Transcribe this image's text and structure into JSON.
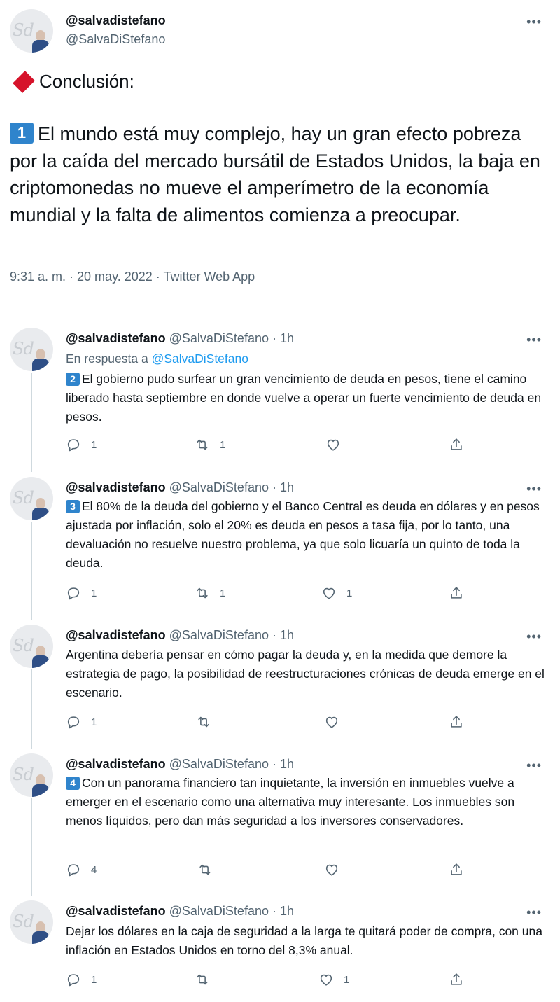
{
  "main_tweet": {
    "display_name": "@salvadistefano",
    "handle": "@SalvaDiStefano",
    "heading": "Conclusión:",
    "keycap": "1",
    "body": "El mundo está muy complejo, hay un gran efecto pobreza por la caída del mercado bursátil de Estados Unidos, la baja en criptomonedas no mueve el amperímetro de la economía mundial y la falta de alimentos comienza a preocupar.",
    "meta": "9:31 a. m. · 20 may. 2022 · Twitter Web App",
    "more_label": "•••"
  },
  "replies": [
    {
      "display_name": "@salvadistefano",
      "handle": "@SalvaDiStefano · 1h",
      "reply_to_prefix": "En respuesta a ",
      "reply_to_mention": "@SalvaDiStefano",
      "keycap": "2",
      "text": "El gobierno pudo surfear un gran vencimiento de deuda en pesos, tiene el camino liberado hasta septiembre en donde vuelve a operar un fuerte vencimiento de deuda en pesos.",
      "reply_count": "1",
      "retweet_count": "1",
      "like_count": ""
    },
    {
      "display_name": "@salvadistefano",
      "handle": "@SalvaDiStefano · 1h",
      "keycap": "3",
      "text": "El 80% de la deuda del gobierno y el Banco Central es deuda en dólares y en pesos ajustada por inflación, solo el 20% es deuda en pesos a tasa fija, por lo tanto, una devaluación no resuelve nuestro problema, ya que solo licuaría un quinto de toda la deuda.",
      "reply_count": "1",
      "retweet_count": "1",
      "like_count": "1"
    },
    {
      "display_name": "@salvadistefano",
      "handle": "@SalvaDiStefano · 1h",
      "keycap": "",
      "text": "Argentina debería pensar en cómo pagar la deuda y, en la medida que demore la estrategia de pago, la posibilidad de reestructuraciones crónicas de deuda emerge en el escenario.",
      "reply_count": "1",
      "retweet_count": "",
      "like_count": ""
    },
    {
      "display_name": "@salvadistefano",
      "handle": "@SalvaDiStefano · 1h",
      "keycap": "4",
      "text": "Con un panorama financiero tan inquietante, la inversión en inmuebles vuelve a emerger en el escenario como una alternativa muy interesante. Los inmuebles son menos líquidos, pero dan más seguridad a los inversores conservadores.",
      "reply_count": "4",
      "retweet_count": "",
      "like_count": ""
    },
    {
      "display_name": "@salvadistefano",
      "handle": "@SalvaDiStefano · 1h",
      "keycap": "",
      "text": "Dejar los dólares en la caja de seguridad a la larga te quitará poder de compra, con una inflación en Estados Unidos en torno del 8,3% anual.",
      "reply_count": "1",
      "retweet_count": "",
      "like_count": "1"
    }
  ],
  "icons": {
    "reply": "reply-icon",
    "retweet": "retweet-icon",
    "like": "heart-icon",
    "share": "share-icon",
    "more": "more-icon"
  },
  "colors": {
    "text": "#0f1419",
    "secondary": "#536471",
    "link": "#1d9bf0",
    "diamond": "#d6132a",
    "keycap": "#2f84cc",
    "thread_line": "#cfd9de"
  }
}
